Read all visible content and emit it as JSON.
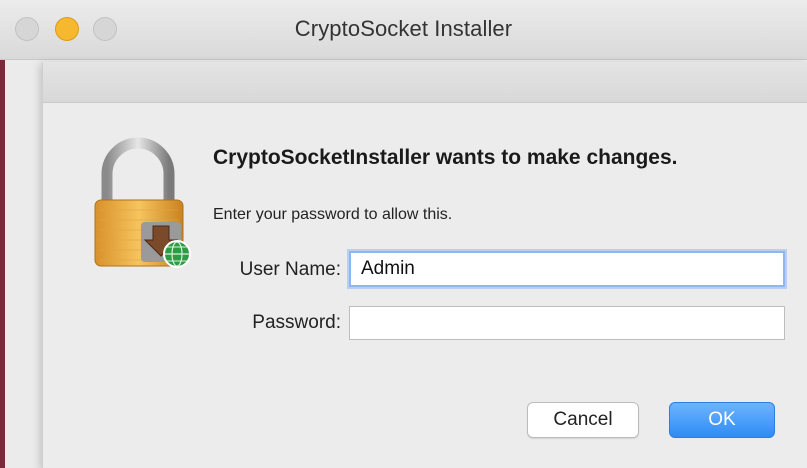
{
  "window": {
    "title": "CryptoSocket Installer"
  },
  "dialog": {
    "heading": "CryptoSocketInstaller wants to make changes.",
    "subtext": "Enter your password to allow this.",
    "username_label": "User Name:",
    "username_value": "Admin",
    "password_label": "Password:",
    "password_value": "",
    "cancel_label": "Cancel",
    "ok_label": "OK"
  },
  "icons": {
    "lock": "lock-icon",
    "download": "download-arrow-icon",
    "globe": "globe-badge-icon"
  },
  "colors": {
    "accent": "#2e8cf4",
    "focus_ring": "#8fb7ec",
    "minimize": "#f5b82e"
  }
}
